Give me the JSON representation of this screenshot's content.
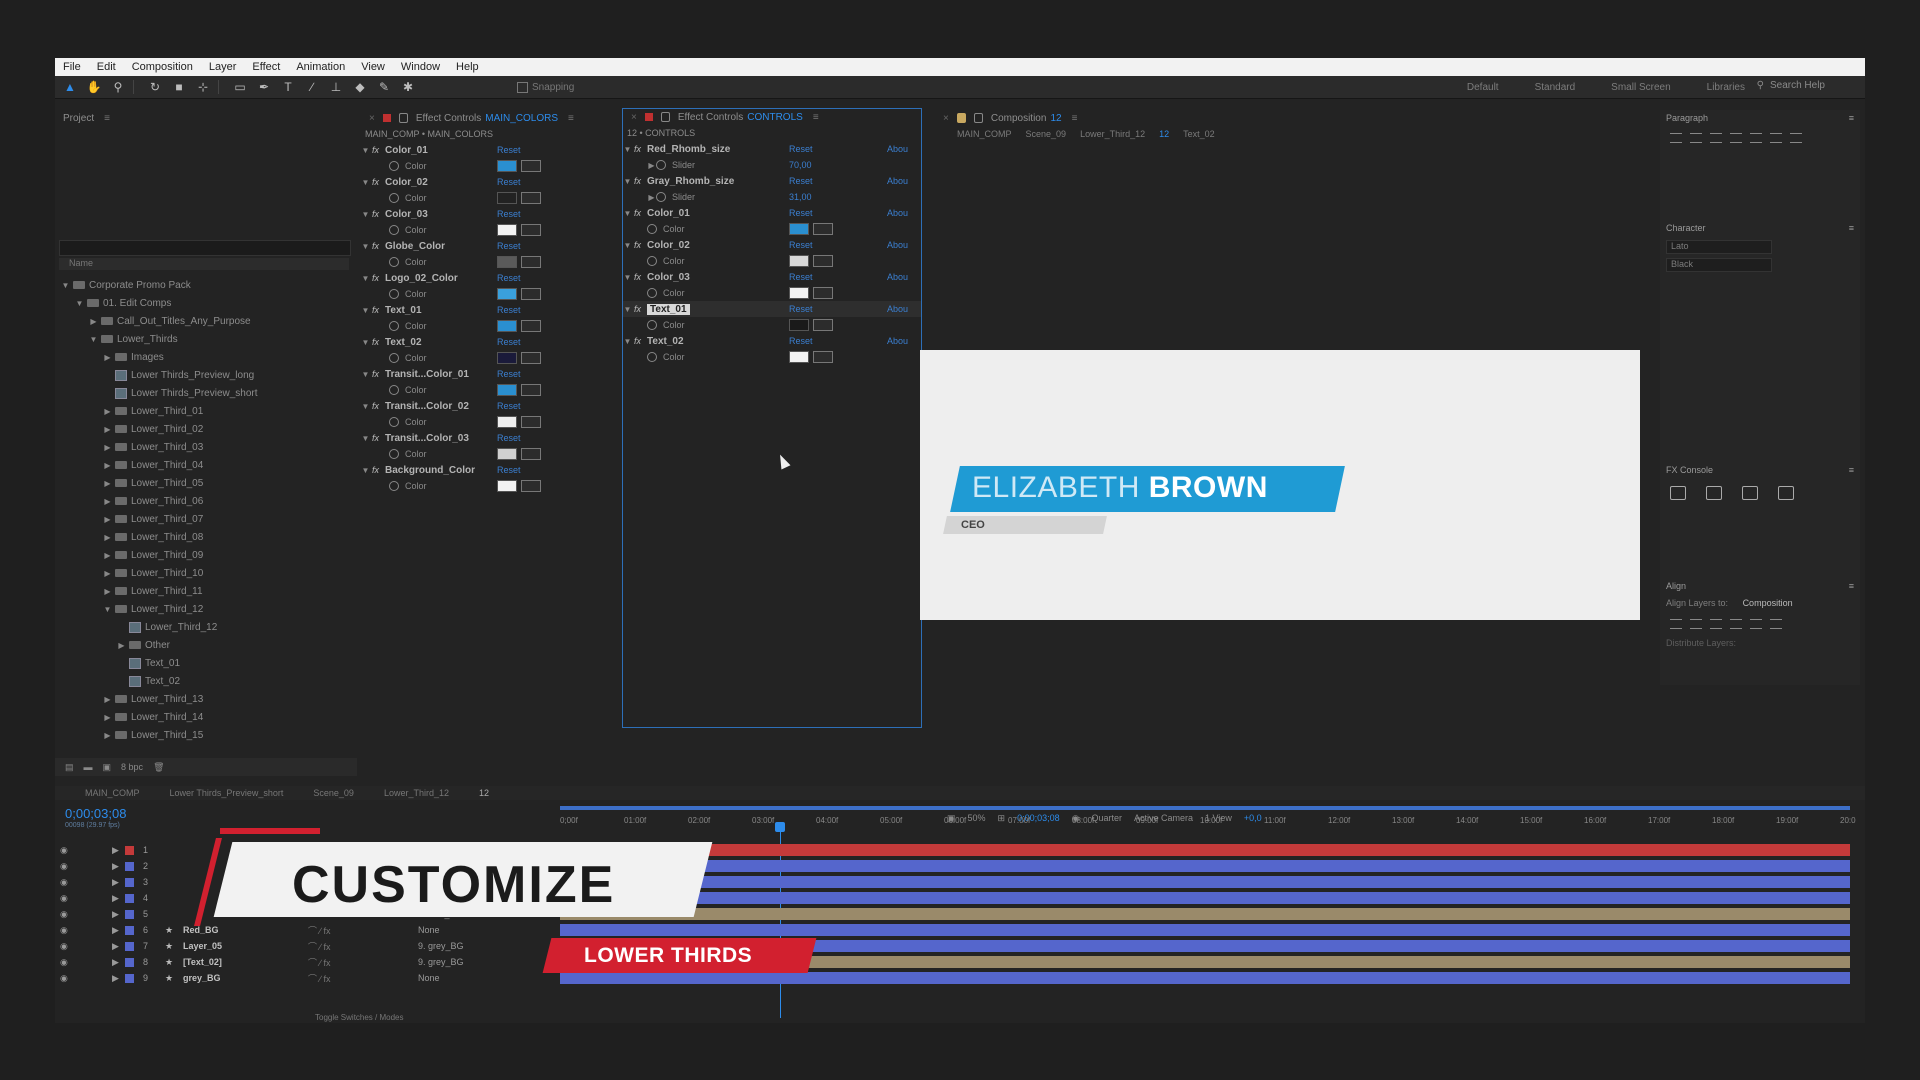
{
  "menu": [
    "File",
    "Edit",
    "Composition",
    "Layer",
    "Effect",
    "Animation",
    "View",
    "Window",
    "Help"
  ],
  "toolbar": {
    "snapping": "Snapping",
    "workspaces": [
      "Default",
      "Standard",
      "Small Screen",
      "Libraries"
    ],
    "search_help": "Search Help"
  },
  "project": {
    "title": "Project",
    "column": "Name",
    "items": [
      {
        "label": "Corporate Promo Pack",
        "indent": 0,
        "type": "folder",
        "open": true
      },
      {
        "label": "01. Edit Comps",
        "indent": 1,
        "type": "folder",
        "open": true
      },
      {
        "label": "Call_Out_Titles_Any_Purpose",
        "indent": 2,
        "type": "folder",
        "open": false
      },
      {
        "label": "Lower_Thirds",
        "indent": 2,
        "type": "folder",
        "open": true
      },
      {
        "label": "Images",
        "indent": 3,
        "type": "folder",
        "open": false
      },
      {
        "label": "Lower Thirds_Preview_long",
        "indent": 3,
        "type": "comp"
      },
      {
        "label": "Lower Thirds_Preview_short",
        "indent": 3,
        "type": "comp"
      },
      {
        "label": "Lower_Third_01",
        "indent": 3,
        "type": "folder",
        "open": false
      },
      {
        "label": "Lower_Third_02",
        "indent": 3,
        "type": "folder",
        "open": false
      },
      {
        "label": "Lower_Third_03",
        "indent": 3,
        "type": "folder",
        "open": false
      },
      {
        "label": "Lower_Third_04",
        "indent": 3,
        "type": "folder",
        "open": false
      },
      {
        "label": "Lower_Third_05",
        "indent": 3,
        "type": "folder",
        "open": false
      },
      {
        "label": "Lower_Third_06",
        "indent": 3,
        "type": "folder",
        "open": false
      },
      {
        "label": "Lower_Third_07",
        "indent": 3,
        "type": "folder",
        "open": false
      },
      {
        "label": "Lower_Third_08",
        "indent": 3,
        "type": "folder",
        "open": false
      },
      {
        "label": "Lower_Third_09",
        "indent": 3,
        "type": "folder",
        "open": false
      },
      {
        "label": "Lower_Third_10",
        "indent": 3,
        "type": "folder",
        "open": false
      },
      {
        "label": "Lower_Third_11",
        "indent": 3,
        "type": "folder",
        "open": false
      },
      {
        "label": "Lower_Third_12",
        "indent": 3,
        "type": "folder",
        "open": true
      },
      {
        "label": "Lower_Third_12",
        "indent": 4,
        "type": "comp"
      },
      {
        "label": "Other",
        "indent": 4,
        "type": "folder",
        "open": false
      },
      {
        "label": "Text_01",
        "indent": 4,
        "type": "comp"
      },
      {
        "label": "Text_02",
        "indent": 4,
        "type": "comp"
      },
      {
        "label": "Lower_Third_13",
        "indent": 3,
        "type": "folder",
        "open": false
      },
      {
        "label": "Lower_Third_14",
        "indent": 3,
        "type": "folder",
        "open": false
      },
      {
        "label": "Lower_Third_15",
        "indent": 3,
        "type": "folder",
        "open": false
      }
    ],
    "footer_bpc": "8 bpc"
  },
  "fx1": {
    "title": "Effect Controls",
    "accent": "MAIN_COLORS",
    "path": "MAIN_COMP • MAIN_COLORS",
    "reset": "Reset",
    "sub": "Color",
    "effects": [
      {
        "name": "Color_01",
        "swatch": "#2a8fd0"
      },
      {
        "name": "Color_02",
        "swatch": "#222222"
      },
      {
        "name": "Color_03",
        "swatch": "#f2f2f2"
      },
      {
        "name": "Globe_Color",
        "swatch": "#5a5a5a"
      },
      {
        "name": "Logo_02_Color",
        "swatch": "#3aa0dc"
      },
      {
        "name": "Text_01",
        "swatch": "#2a8fd0"
      },
      {
        "name": "Text_02",
        "swatch": "#1a1a3a"
      },
      {
        "name": "Transit...Color_01",
        "swatch": "#2a8fd0"
      },
      {
        "name": "Transit...Color_02",
        "swatch": "#eeeeee"
      },
      {
        "name": "Transit...Color_03",
        "swatch": "#d0d0d0"
      },
      {
        "name": "Background_Color",
        "swatch": "#f2f2f2"
      }
    ]
  },
  "fx2": {
    "title": "Effect Controls",
    "accent": "CONTROLS",
    "path": "12 • CONTROLS",
    "reset": "Reset",
    "about": "Abou",
    "effects": [
      {
        "name": "Red_Rhomb_size",
        "sub": "Slider",
        "value": "70,00"
      },
      {
        "name": "Gray_Rhomb_size",
        "sub": "Slider",
        "value": "31,00"
      },
      {
        "name": "Color_01",
        "sub": "Color",
        "swatch": "#2a8fd0"
      },
      {
        "name": "Color_02",
        "sub": "Color",
        "swatch": "#d8d8d8"
      },
      {
        "name": "Color_03",
        "sub": "Color",
        "swatch": "#f2f2f2"
      },
      {
        "name": "Text_01",
        "sub": "Color",
        "swatch": "#1a1a1a",
        "selected": true
      },
      {
        "name": "Text_02",
        "sub": "Color",
        "swatch": "#f2f2f2"
      }
    ]
  },
  "comp": {
    "title": "Composition",
    "accent": "12",
    "breadcrumb": [
      "MAIN_COMP",
      "Scene_09",
      "Lower_Third_12",
      "12",
      "Text_02"
    ],
    "name_light": "ELIZABETH",
    "name_bold": "BROWN",
    "role": "CEO",
    "footer": {
      "zoom": "50%",
      "time": "0;00;03;08",
      "quality": "Quarter",
      "camera": "Active Camera",
      "view": "1 View",
      "exposure": "+0,0"
    }
  },
  "right": {
    "paragraph": "Paragraph",
    "character": "Character",
    "font": "Lato",
    "weight": "Black",
    "fx_console": "FX Console",
    "align": "Align",
    "align_to_label": "Align Layers to:",
    "align_to": "Composition",
    "distribute": "Distribute Layers:"
  },
  "timeline": {
    "tabs": [
      "MAIN_COMP",
      "Lower Thirds_Preview_short",
      "Scene_09",
      "Lower_Third_12",
      "12"
    ],
    "time": "0;00;03;08",
    "time_sub": "00098 (29.97 fps)",
    "ticks": [
      "0;00f",
      "01:00f",
      "02:00f",
      "03:00f",
      "04:00f",
      "05:00f",
      "06:00f",
      "07:00f",
      "08:00f",
      "09:00f",
      "10:00f",
      "11:00f",
      "12:00f",
      "13:00f",
      "14:00f",
      "15:00f",
      "16:00f",
      "17:00f",
      "18:00f",
      "19:00f",
      "20:0"
    ],
    "layers": [
      {
        "num": "1",
        "name": "",
        "parent": "",
        "color": "#c43a3a"
      },
      {
        "num": "2",
        "name": "",
        "parent": "",
        "color": "#5566cc"
      },
      {
        "num": "3",
        "name": "",
        "parent": "",
        "color": "#5566cc"
      },
      {
        "num": "4",
        "name": "",
        "parent": "",
        "color": "#5566cc"
      },
      {
        "num": "5",
        "name": "",
        "parent": "6. Red_BG",
        "color": "#9a8a6a"
      },
      {
        "num": "6",
        "name": "Red_BG",
        "parent": "None",
        "color": "#5566cc"
      },
      {
        "num": "7",
        "name": "Layer_05",
        "parent": "9. grey_BG",
        "color": "#5566cc"
      },
      {
        "num": "8",
        "name": "[Text_02]",
        "parent": "9. grey_BG",
        "color": "#9a8a6a"
      },
      {
        "num": "9",
        "name": "grey_BG",
        "parent": "None",
        "color": "#5566cc"
      }
    ],
    "footer": "Toggle Switches / Modes"
  },
  "overlay": {
    "title": "CUSTOMIZE",
    "subtitle": "LOWER THIRDS"
  }
}
